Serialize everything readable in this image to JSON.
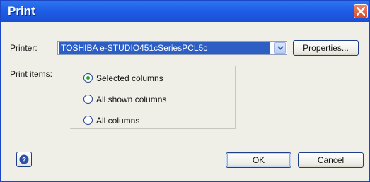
{
  "title": "Print",
  "printer": {
    "label": "Printer:",
    "value": "TOSHIBA e-STUDIO451cSeriesPCL5c",
    "properties_label": "Properties..."
  },
  "print_items": {
    "label": "Print items:",
    "options": [
      {
        "label": "Selected columns",
        "selected": true
      },
      {
        "label": "All shown columns",
        "selected": false
      },
      {
        "label": "All columns",
        "selected": false
      }
    ]
  },
  "footer": {
    "ok_label": "OK",
    "cancel_label": "Cancel",
    "help_icon": "help-icon"
  },
  "colors": {
    "titlebar": "#2d77f0",
    "selection": "#2c5ec4",
    "close_button": "#e0573a",
    "radio_selected": "#2aa02a"
  }
}
